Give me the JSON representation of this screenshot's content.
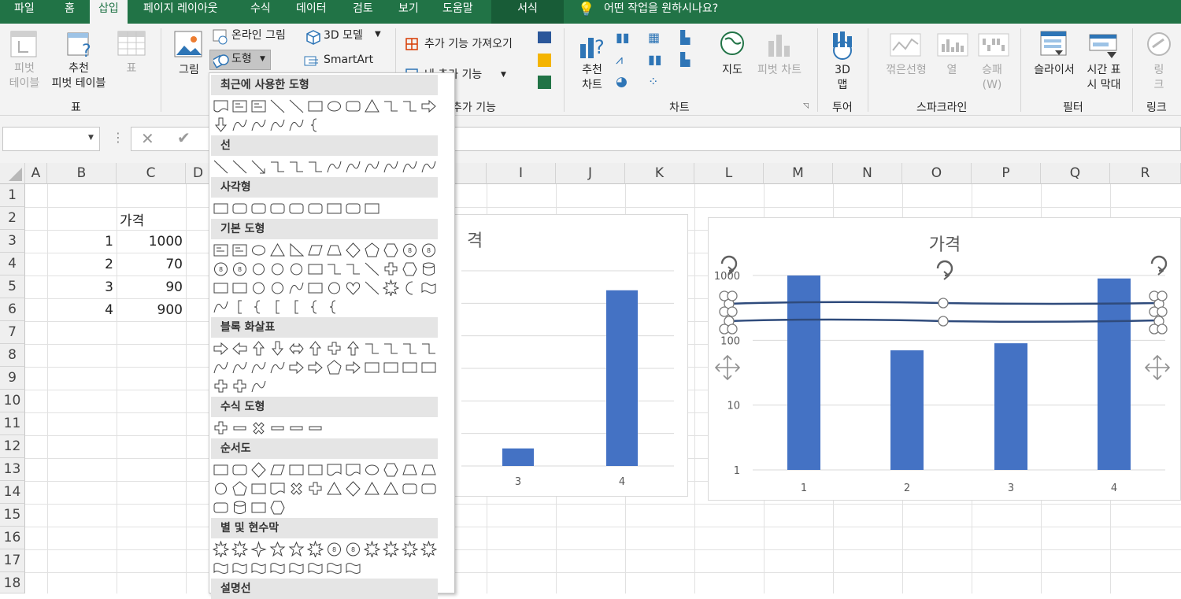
{
  "tabs": [
    "파일",
    "홈",
    "삽입",
    "페이지 레이아웃",
    "수식",
    "데이터",
    "검토",
    "보기",
    "도움말",
    "서식"
  ],
  "tell_me": "어떤 작업을 원하시나요?",
  "ribbon": {
    "pivot": "피벗\n테이블",
    "rec_pivot": "추천\n피벗 테이블",
    "table": "표",
    "group_table": "표",
    "picture": "그림",
    "online_pic": "온라인 그림",
    "model3d": "3D 모델",
    "shapes": "도형",
    "smartart": "SmartArt",
    "get_addins": "추가 기능 가져오기",
    "my_addins": "내 추가 기능",
    "group_addins": "추가 기능",
    "rec_chart": "추천\n차트",
    "map": "지도",
    "pivot_chart": "피벗 차트",
    "group_chart": "차트",
    "map3d": "3D\n맵",
    "group_tour": "투어",
    "line": "꺾은선형",
    "column": "열",
    "winloss": "승패\n(W)",
    "group_spark": "스파크라인",
    "slicer": "슬라이서",
    "timeline": "시간 표\n시 막대",
    "group_filter": "필터",
    "link": "링\n크",
    "group_link": "링크"
  },
  "namebox": "",
  "columns": [
    "A",
    "B",
    "C",
    "D",
    "I",
    "J",
    "K",
    "L",
    "M",
    "N",
    "O",
    "P",
    "Q",
    "R"
  ],
  "rows": [
    "1",
    "2",
    "3",
    "4",
    "5",
    "6",
    "7",
    "8",
    "9",
    "10",
    "11",
    "12",
    "13",
    "14",
    "15",
    "16",
    "17",
    "18"
  ],
  "cells": {
    "c2": "가격",
    "b3": "1",
    "c3": "1000",
    "b4": "2",
    "c4": "70",
    "b5": "3",
    "c5": "90",
    "b6": "4",
    "c6": "900"
  },
  "shape_menu": {
    "recent": "최근에 사용한 도형",
    "lines": "선",
    "rects": "사각형",
    "basic": "기본 도형",
    "arrows": "블록 화살표",
    "equation": "수식 도형",
    "flowchart": "순서도",
    "stars": "별 및 현수막",
    "callouts": "설명선"
  },
  "chart_data": [
    {
      "type": "bar",
      "title": "격",
      "categories": [
        "3",
        "4"
      ],
      "values": [
        90,
        900
      ],
      "ylim": [
        0,
        1000
      ]
    },
    {
      "type": "bar",
      "title": "가격",
      "categories": [
        "1",
        "2",
        "3",
        "4"
      ],
      "values": [
        1000,
        70,
        90,
        900
      ],
      "yscale": "log",
      "yticks": [
        "1",
        "10",
        "100",
        "1000"
      ],
      "ylim": [
        1,
        1000
      ]
    }
  ],
  "colors": {
    "excel_green": "#217346",
    "bar": "#4472c4"
  }
}
